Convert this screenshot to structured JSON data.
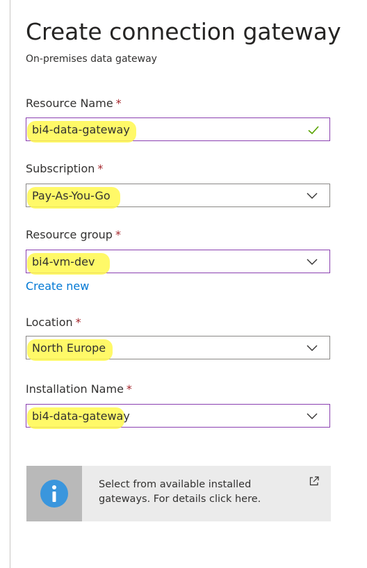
{
  "header": {
    "title": "Create connection gateway",
    "subtitle": "On-premises data gateway"
  },
  "form": {
    "resource_name": {
      "label": "Resource Name",
      "required": "*",
      "value": "bi4-data-gateway",
      "status_icon": "check-icon"
    },
    "subscription": {
      "label": "Subscription",
      "required": "*",
      "value": "Pay-As-You-Go"
    },
    "resource_group": {
      "label": "Resource group",
      "required": "*",
      "value": "bi4-vm-dev",
      "create_new": "Create new"
    },
    "location": {
      "label": "Location",
      "required": "*",
      "value": "North Europe"
    },
    "installation_name": {
      "label": "Installation Name",
      "required": "*",
      "value": "bi4-data-gateway"
    }
  },
  "info": {
    "icon": "info-icon",
    "text": "Select from available installed gateways. For details click here.",
    "link_icon": "external-link-icon"
  },
  "colors": {
    "accent": "#0078d4",
    "required": "#a4262c",
    "focus_border": "#8a3fb0",
    "success": "#57a300",
    "highlight": "#fff84d"
  }
}
